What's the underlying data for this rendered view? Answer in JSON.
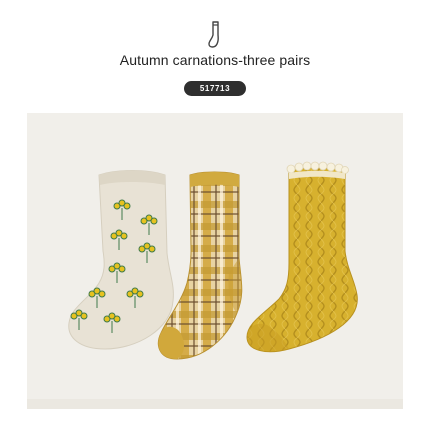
{
  "product": {
    "title": "Autumn carnations-three pairs",
    "sku": "517713"
  },
  "icons": {
    "header": "sock-icon"
  },
  "colors": {
    "mustard": "#d4ae34",
    "oatmeal": "#e9e3d6",
    "flower": "#e7c21f",
    "leaf": "#3f7a4a",
    "badge": "#2f2f2f"
  }
}
